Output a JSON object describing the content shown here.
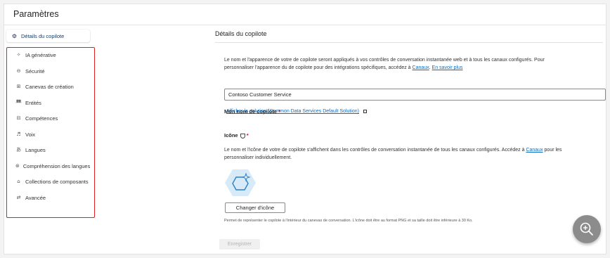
{
  "header": {
    "title": "Paramètres"
  },
  "sidebar": {
    "selected": {
      "icon": "gear-icon",
      "label": "Détails du copilote"
    },
    "items": [
      {
        "icon": "sparkle-icon",
        "label": "IA générative"
      },
      {
        "icon": "lock-icon",
        "label": "Sécurité"
      },
      {
        "icon": "grid-icon",
        "label": "Canevas de création"
      },
      {
        "icon": "entity-icon",
        "label": "Entités"
      },
      {
        "icon": "skills-icon",
        "label": "Compétences"
      },
      {
        "icon": "voice-icon",
        "label": "Voix"
      },
      {
        "icon": "language-icon",
        "label": "Langues"
      },
      {
        "icon": "brain-icon",
        "label": "Compréhension des langues"
      },
      {
        "icon": "collection-icon",
        "label": "Collections de composants"
      },
      {
        "icon": "settings-sliders-icon",
        "label": "Avancée"
      }
    ]
  },
  "main": {
    "section_title": "Détails du copilote",
    "intro_line1": "Le nom et l'apparence de votre de copilote seront appliqués à vos contrôles de conversation instantanée web et à tous les canaux configurés. Pour",
    "intro_line2": "personnaliser l'apparence du de copilote pour des intégrations spécifiques, accédez à",
    "intro_link1": "Canaux",
    "intro_link2": "En savoir plus",
    "name_label": "Mon nom de copilote",
    "name_required": "*",
    "name_value": "Contoso Customer Service",
    "solution_link": "Afficher la solution (Common Data Services Default Solution)",
    "icon_label": "Icône",
    "icon_required": "*",
    "icon_desc_line1": "Le nom et l'icône de votre de copilote s'affichent dans les contrôles de conversation instantanée de tous les canaux configurés. Accédez à",
    "icon_desc_link": "Canaux",
    "icon_desc_after": "pour les",
    "icon_desc_line2": "personnaliser individuellement.",
    "change_icon_button": "Changer d'icône",
    "icon_note": "Permet de représenter le copilote à l'intérieur du canevas de conversation. L'icône doit être au format PNG et sa taille doit être inférieure à 30 Ko.",
    "save_button": "Enregistrer"
  },
  "fab": {
    "icon": "zoom-in-icon"
  },
  "colors": {
    "accent": "#0f6cbd",
    "highlight": "#e02020",
    "required": "#c50f1f",
    "fab": "#8c8c8c"
  }
}
